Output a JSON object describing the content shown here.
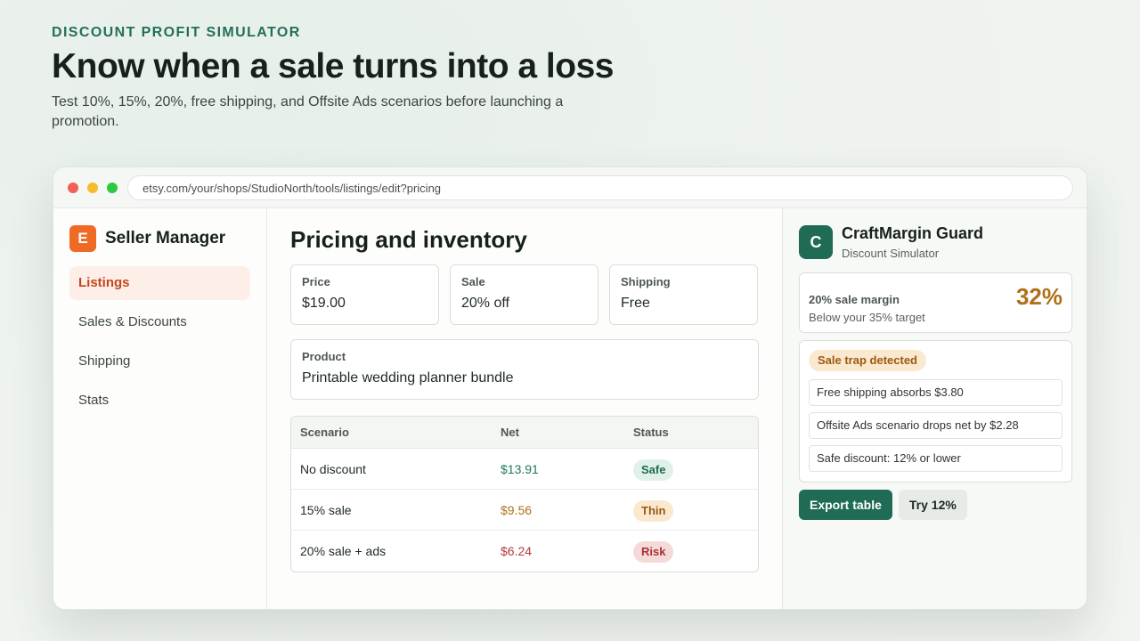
{
  "hero": {
    "eyebrow": "DISCOUNT PROFIT SIMULATOR",
    "headline": "Know when a sale turns into a loss",
    "subhead": "Test 10%, 15%, 20%, free shipping, and Offsite Ads scenarios before launching a promotion."
  },
  "browser": {
    "url": "etsy.com/your/shops/StudioNorth/tools/listings/edit?pricing"
  },
  "sidebar": {
    "logo_letter": "E",
    "brand": "Seller Manager",
    "items": [
      {
        "label": "Listings",
        "active": true
      },
      {
        "label": "Sales & Discounts",
        "active": false
      },
      {
        "label": "Shipping",
        "active": false
      },
      {
        "label": "Stats",
        "active": false
      }
    ]
  },
  "main": {
    "title": "Pricing and inventory",
    "fields": [
      {
        "label": "Price",
        "value": "$19.00"
      },
      {
        "label": "Sale",
        "value": "20% off"
      },
      {
        "label": "Shipping",
        "value": "Free"
      }
    ],
    "product": {
      "label": "Product",
      "value": "Printable wedding planner bundle"
    },
    "table": {
      "headers": [
        "Scenario",
        "Net",
        "Status"
      ],
      "rows": [
        {
          "scenario": "No discount",
          "net": "$13.91",
          "status": "Safe"
        },
        {
          "scenario": "15% sale",
          "net": "$9.56",
          "status": "Thin"
        },
        {
          "scenario": "20% sale + ads",
          "net": "$6.24",
          "status": "Risk"
        }
      ]
    }
  },
  "panel": {
    "logo_letter": "C",
    "title": "CraftMargin Guard",
    "subtitle": "Discount Simulator",
    "margin": {
      "label": "20% sale margin",
      "note": "Below your 35% target",
      "value": "32%"
    },
    "trap": {
      "badge": "Sale trap detected",
      "items": [
        "Free shipping absorbs $3.80",
        "Offsite Ads scenario drops net by $2.28",
        "Safe discount: 12% or lower"
      ]
    },
    "actions": {
      "export_label": "Export table",
      "try_label": "Try 12%"
    }
  },
  "colors": {
    "accent": "#1f6b55",
    "brand_orange": "#ef6a24",
    "safe": "#1f7a55",
    "thin": "#b0701a",
    "risk": "#b23b3b"
  }
}
